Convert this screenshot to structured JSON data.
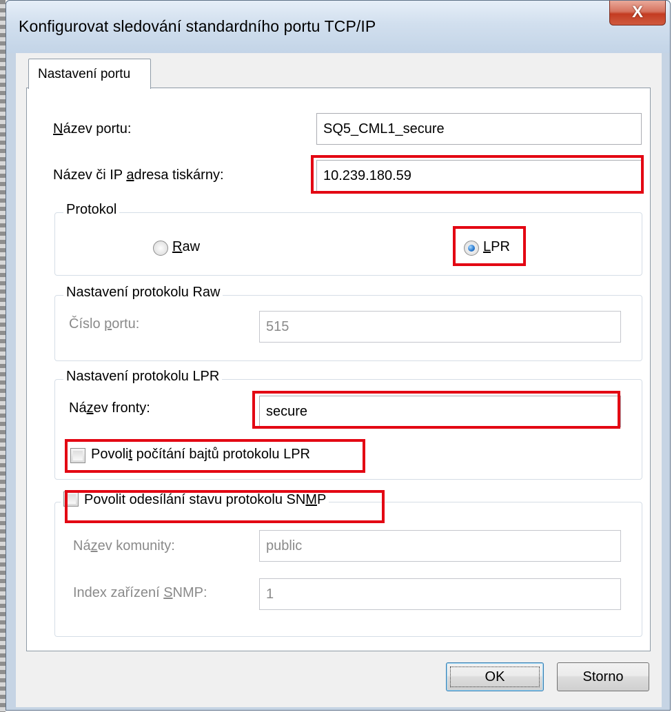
{
  "window": {
    "title": "Konfigurovat sledování standardního portu TCP/IP",
    "close_glyph": "X"
  },
  "tab": {
    "label": "Nastavení portu"
  },
  "port_name": {
    "label_accel": "N",
    "label_rest": "ázev portu:",
    "value": "SQ5_CML1_secure"
  },
  "printer_address": {
    "label_pre": "Název či IP ",
    "label_accel": "a",
    "label_post": "dresa tiskárny:",
    "value": "10.239.180.59"
  },
  "protocol": {
    "legend": "Protokol",
    "raw_accel": "R",
    "raw_rest": "aw",
    "lpr_accel": "L",
    "lpr_rest": "PR",
    "selected": "LPR"
  },
  "raw_settings": {
    "legend": "Nastavení protokolu Raw",
    "port_label_pre": "Číslo ",
    "port_label_accel": "p",
    "port_label_post": "ortu:",
    "port_value": "515"
  },
  "lpr_settings": {
    "legend": "Nastavení protokolu LPR",
    "queue_label_pre": "Ná",
    "queue_label_accel": "z",
    "queue_label_post": "ev fronty:",
    "queue_value": "secure",
    "byte_count_pre": "Povoli",
    "byte_count_accel": "t",
    "byte_count_post": " počítání bajtů protokolu LPR",
    "byte_count_checked": false
  },
  "snmp": {
    "enable_pre": "Povolit odesílání stavu protokolu SN",
    "enable_accel": "M",
    "enable_post": "P",
    "enable_checked": false,
    "community_label_pre": "Ná",
    "community_label_accel": "z",
    "community_label_post": "ev komunity:",
    "community_value": "public",
    "device_index_pre": "Index zařízení ",
    "device_index_accel": "S",
    "device_index_post": "NMP:",
    "device_index_value": "1"
  },
  "buttons": {
    "ok": "OK",
    "cancel": "Storno"
  },
  "colors": {
    "highlight": "#e30613",
    "panel": "#ffffff",
    "client": "#f0f0f0"
  }
}
